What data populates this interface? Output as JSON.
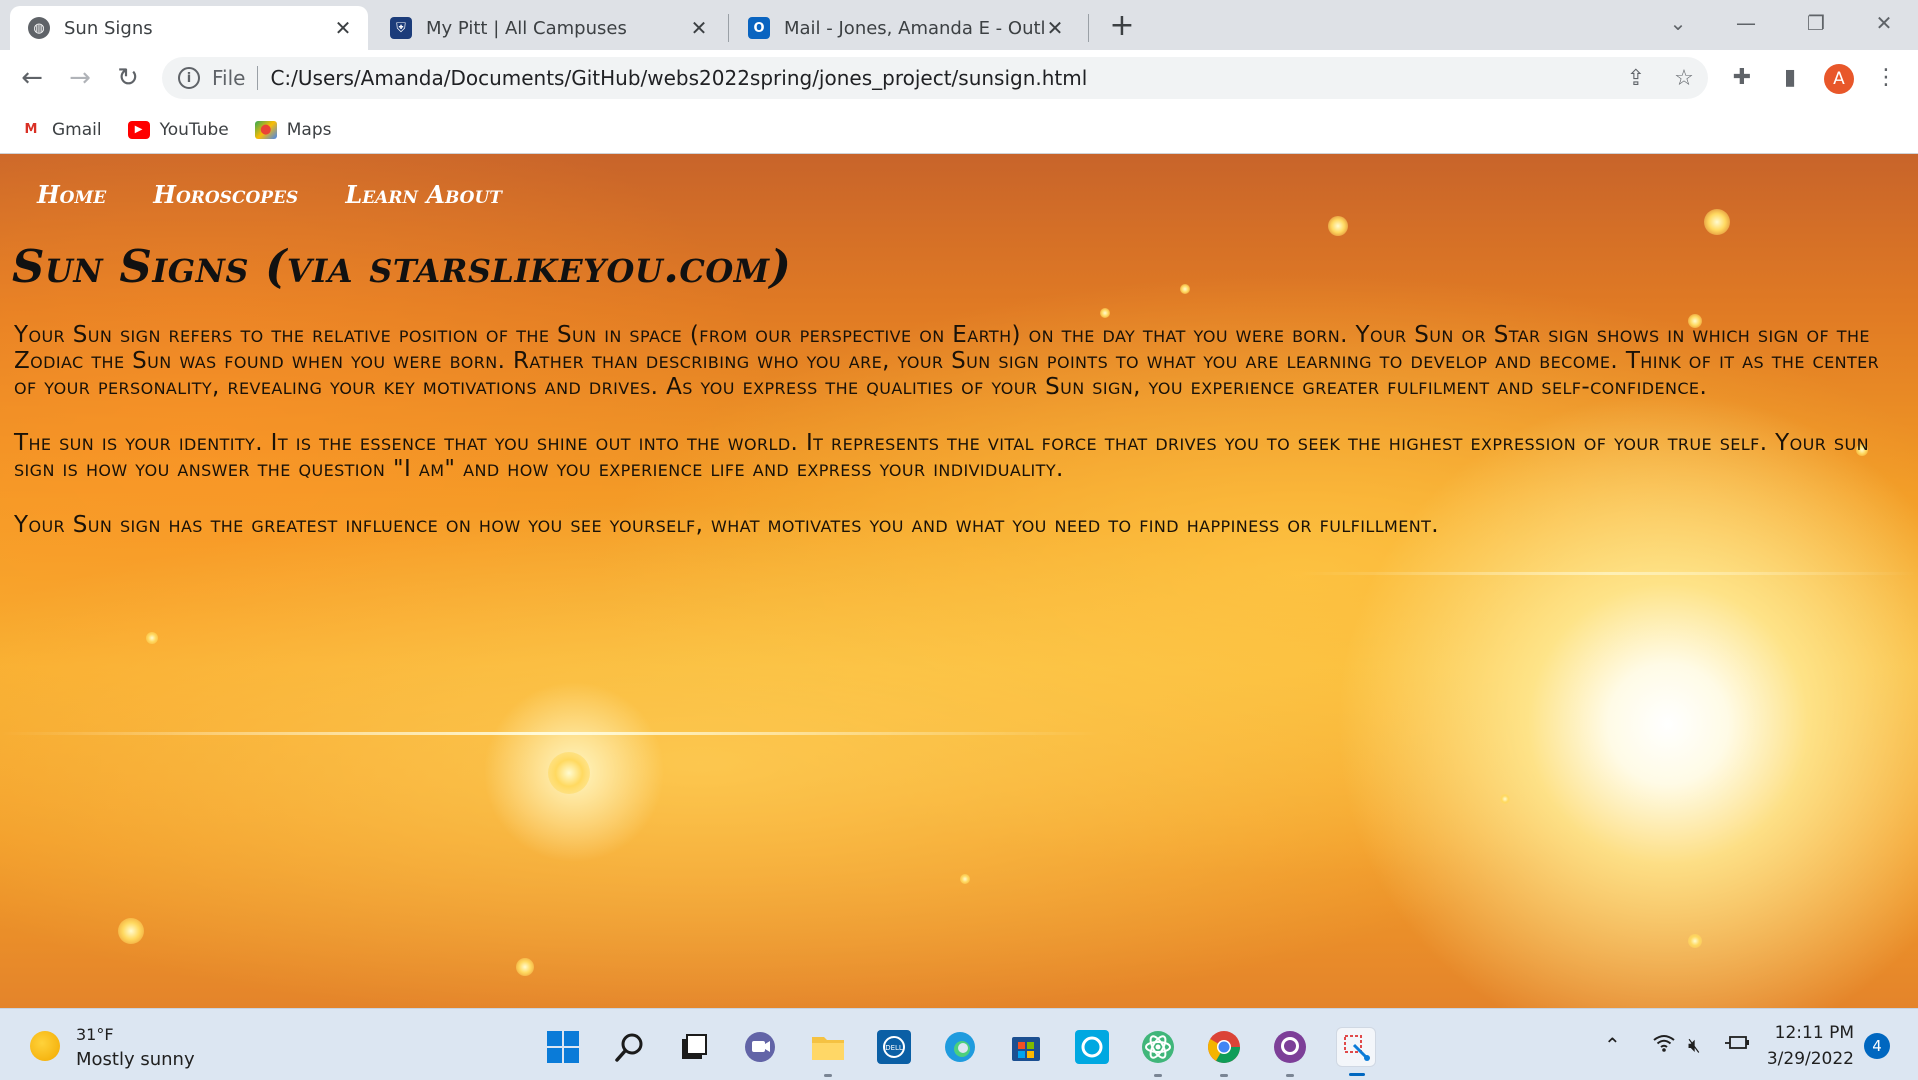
{
  "browser": {
    "tabs": [
      {
        "title": "Sun Signs",
        "active": true,
        "icon": "globe-icon"
      },
      {
        "title": "My Pitt | All Campuses",
        "active": false,
        "icon": "pitt-crest-icon"
      },
      {
        "title": "Mail - Jones, Amanda E - Outlook",
        "active": false,
        "icon": "outlook-icon"
      }
    ],
    "address": {
      "scheme": "File",
      "url": "C:/Users/Amanda/Documents/GitHub/webs2022spring/jones_project/sunsign.html"
    },
    "profile_initial": "A",
    "bookmarks": [
      {
        "label": "Gmail",
        "icon": "gmail-icon"
      },
      {
        "label": "YouTube",
        "icon": "youtube-icon"
      },
      {
        "label": "Maps",
        "icon": "maps-icon"
      }
    ]
  },
  "page": {
    "nav": [
      "Home",
      "Horoscopes",
      "Learn About"
    ],
    "heading": "Sun Signs (via starslikeyou.com)",
    "paragraphs": [
      "Your Sun sign refers to the relative position of the Sun in space (from our perspective on Earth) on the day that you were born. Your Sun or Star sign shows in which sign of the Zodiac the Sun was found when you were born. Rather than describing who you are, your Sun sign points to what you are learning to develop and become. Think of it as the center of your personality, revealing your key motivations and drives. As you express the qualities of your Sun sign, you experience greater fulfilment and self-confidence.",
      "The sun is your identity. It is the essence that you shine out into the world. It represents the vital force that drives you to seek the highest expression of your true self. Your sun sign is how you answer the question \"I am\" and how you experience life and express your individuality.",
      "Your Sun sign has the greatest influence on how you see yourself, what motivates you and what you need to find happiness or fulfillment."
    ]
  },
  "taskbar": {
    "weather": {
      "temp": "31°F",
      "desc": "Mostly sunny"
    },
    "time": "12:11 PM",
    "date": "3/29/2022",
    "notifications": "4"
  }
}
